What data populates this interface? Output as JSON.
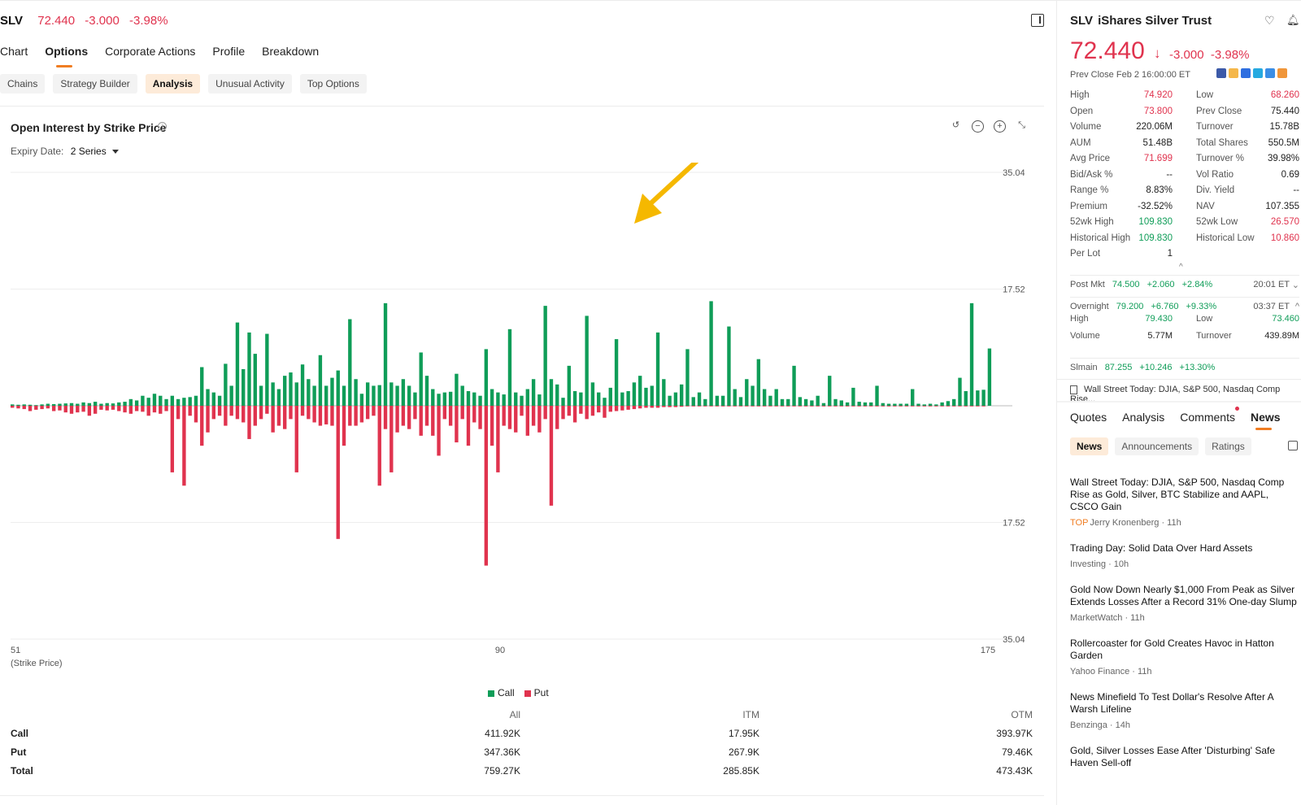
{
  "header": {
    "symbol": "SLV",
    "price": "72.440",
    "change": "-3.000",
    "change_pct": "-3.98%"
  },
  "tabs": [
    {
      "label": "Chart",
      "active": false
    },
    {
      "label": "Options",
      "active": true
    },
    {
      "label": "Corporate Actions",
      "active": false
    },
    {
      "label": "Profile",
      "active": false
    },
    {
      "label": "Breakdown",
      "active": false
    }
  ],
  "subtabs": [
    {
      "label": "Chains",
      "active": false
    },
    {
      "label": "Strategy Builder",
      "active": false
    },
    {
      "label": "Analysis",
      "active": true
    },
    {
      "label": "Unusual Activity",
      "active": false
    },
    {
      "label": "Top Options",
      "active": false
    }
  ],
  "chart_panel": {
    "title": "Open Interest by Strike Price",
    "expiry_label": "Expiry Date:",
    "expiry_value": "2 Series"
  },
  "chart_data": {
    "type": "bar",
    "xlabel": "(Strike Price)",
    "x_ticks": [
      "51",
      "90",
      "175"
    ],
    "y_ticks": [
      "35.04K",
      "17.52K",
      "0",
      "17.52K",
      "35.04K"
    ],
    "ylim": [
      -35040,
      35040
    ],
    "series": [
      {
        "name": "Call",
        "color": "#0f9d58",
        "values": [
          200,
          150,
          200,
          150,
          100,
          200,
          300,
          250,
          300,
          350,
          400,
          300,
          500,
          400,
          600,
          300,
          400,
          350,
          500,
          600,
          1000,
          800,
          1500,
          1200,
          1800,
          1500,
          1000,
          1500,
          1000,
          1200,
          1300,
          1500,
          5800,
          2500,
          2000,
          1500,
          6300,
          3000,
          12500,
          5500,
          11000,
          7800,
          3000,
          10800,
          3500,
          2500,
          4500,
          5000,
          3500,
          6200,
          4000,
          3000,
          7600,
          3000,
          4200,
          5300,
          3000,
          13000,
          4000,
          1800,
          3500,
          3000,
          3100,
          15400,
          3500,
          3000,
          4000,
          3000,
          2000,
          8000,
          4500,
          2500,
          1800,
          2000,
          2100,
          4800,
          3000,
          2200,
          2000,
          1500,
          8500,
          2500,
          2000,
          1700,
          11500,
          2000,
          1500,
          2500,
          4000,
          1700,
          15000,
          4000,
          3200,
          1200,
          6000,
          2200,
          2000,
          13500,
          3500,
          2000,
          1200,
          2700,
          10000,
          2000,
          2200,
          3500,
          4500,
          2700,
          3000,
          11000,
          4000,
          1500,
          2000,
          3200,
          8500,
          1300,
          2000,
          1000,
          15700,
          1500,
          1500,
          11900,
          2500,
          1300,
          4000,
          3000,
          7000,
          2500,
          1500,
          2500,
          1000,
          1000,
          6000,
          1300,
          1000,
          800,
          1500,
          400,
          4500,
          1000,
          800,
          500,
          2700,
          600,
          500,
          500,
          3000,
          400,
          300,
          300,
          300,
          300,
          2500,
          300,
          200,
          300,
          200,
          500,
          700,
          1000,
          4200,
          2200,
          15400,
          2300,
          2400,
          8600
        ]
      },
      {
        "name": "Put",
        "values": [
          300,
          400,
          500,
          800,
          600,
          500,
          400,
          800,
          700,
          1000,
          1200,
          1000,
          900,
          1500,
          1200,
          600,
          700,
          600,
          800,
          1000,
          1200,
          800,
          900,
          1500,
          1000,
          1200,
          800,
          10000,
          2000,
          12000,
          1500,
          2500,
          6000,
          4000,
          2000,
          1500,
          3000,
          1500,
          2000,
          2500,
          5000,
          3000,
          2000,
          1200,
          4000,
          3000,
          3500,
          2000,
          10000,
          1500,
          2000,
          2500,
          3000,
          2800,
          3000,
          20000,
          6000,
          3000,
          3000,
          2500,
          2000,
          1500,
          12000,
          3500,
          10000,
          4000,
          3000,
          3500,
          2000,
          4500,
          3000,
          4500,
          7500,
          2000,
          3000,
          5500,
          2000,
          6000,
          2500,
          3500,
          24000,
          6000,
          10000,
          3000,
          3500,
          4000,
          1500,
          4500,
          3000,
          4000,
          2000,
          15000,
          3500,
          2000,
          1500,
          2500,
          1200,
          2000,
          1500,
          1000,
          1800,
          900,
          800,
          700,
          600,
          500,
          400,
          300,
          300,
          300,
          200,
          200,
          200,
          150,
          100,
          100,
          100,
          100,
          100,
          100,
          100,
          100,
          100,
          100,
          100,
          100,
          100,
          100,
          100,
          100,
          100,
          100,
          100,
          100,
          100,
          100,
          100,
          100,
          100,
          100,
          100,
          100,
          100,
          100,
          100,
          100,
          100,
          100,
          100,
          100,
          100,
          100,
          100,
          100,
          100,
          100,
          100,
          100,
          100,
          100,
          100,
          100,
          100,
          100,
          100
        ]
      }
    ],
    "legend": [
      {
        "name": "Call",
        "color": "#0f9d58"
      },
      {
        "name": "Put",
        "color": "#e0334e"
      }
    ]
  },
  "summary": {
    "headers": [
      "All",
      "ITM",
      "OTM"
    ],
    "rows": [
      {
        "label": "Call",
        "all": "411.92K",
        "itm": "17.95K",
        "otm": "393.97K"
      },
      {
        "label": "Put",
        "all": "347.36K",
        "itm": "267.9K",
        "otm": "79.46K"
      },
      {
        "label": "Total",
        "all": "759.27K",
        "itm": "285.85K",
        "otm": "473.43K"
      }
    ]
  },
  "right_panel": {
    "symbol": "SLV",
    "name": "iShares Silver Trust",
    "price": "72.440",
    "change": "-3.000",
    "change_pct": "-3.98%",
    "prev_close_text": "Prev Close Feb 2 16:00:00 ET",
    "stats": [
      {
        "k1": "High",
        "v1": "74.920",
        "c1": "red",
        "k2": "Low",
        "v2": "68.260",
        "c2": "red"
      },
      {
        "k1": "Open",
        "v1": "73.800",
        "c1": "red",
        "k2": "Prev Close",
        "v2": "75.440",
        "c2": ""
      },
      {
        "k1": "Volume",
        "v1": "220.06M",
        "c1": "",
        "k2": "Turnover",
        "v2": "15.78B",
        "c2": ""
      },
      {
        "k1": "AUM",
        "v1": "51.48B",
        "c1": "",
        "k2": "Total Shares",
        "v2": "550.5M",
        "c2": ""
      },
      {
        "k1": "Avg Price",
        "v1": "71.699",
        "c1": "red",
        "k2": "Turnover %",
        "v2": "39.98%",
        "c2": ""
      },
      {
        "k1": "Bid/Ask %",
        "v1": "--",
        "c1": "",
        "k2": "Vol Ratio",
        "v2": "0.69",
        "c2": ""
      },
      {
        "k1": "Range %",
        "v1": "8.83%",
        "c1": "",
        "k2": "Div. Yield",
        "v2": "--",
        "c2": ""
      },
      {
        "k1": "Premium",
        "v1": "-32.52%",
        "c1": "",
        "k2": "NAV",
        "v2": "107.355",
        "c2": ""
      },
      {
        "k1": "52wk High",
        "v1": "109.830",
        "c1": "green",
        "k2": "52wk Low",
        "v2": "26.570",
        "c2": "red"
      },
      {
        "k1": "Historical High",
        "v1": "109.830",
        "c1": "green",
        "k2": "Historical Low",
        "v2": "10.860",
        "c2": "red"
      },
      {
        "k1": "Per Lot",
        "v1": "1",
        "c1": "",
        "k2": "",
        "v2": "",
        "c2": ""
      }
    ],
    "post_mkt": {
      "label": "Post Mkt",
      "price": "74.500",
      "change": "+2.060",
      "pct": "+2.84%",
      "time": "20:01 ET"
    },
    "overnight": {
      "label": "Overnight",
      "price": "79.200",
      "change": "+6.760",
      "pct": "+9.33%",
      "time": "03:37 ET"
    },
    "overnight_stats": [
      {
        "k1": "High",
        "v1": "79.430",
        "k2": "Low",
        "v2": "73.460"
      },
      {
        "k1": "Volume",
        "v1": "5.77M",
        "k2": "Turnover",
        "v2": "439.89M"
      }
    ],
    "slmain": {
      "label": "Slmain",
      "price": "87.255",
      "change": "+10.246",
      "pct": "+13.30%"
    },
    "news_brief": "Wall Street Today: DJIA, S&P 500, Nasdaq Comp Rise...",
    "tabs": [
      {
        "label": "Quotes",
        "active": false
      },
      {
        "label": "Analysis",
        "active": false
      },
      {
        "label": "Comments",
        "active": false
      },
      {
        "label": "News",
        "active": true
      }
    ],
    "subtabs": [
      {
        "label": "News",
        "active": true
      },
      {
        "label": "Announcements",
        "active": false
      },
      {
        "label": "Ratings",
        "active": false
      }
    ],
    "news": [
      {
        "title": "Wall Street Today: DJIA, S&P 500, Nasdaq Comp Rise as Gold, Silver, BTC Stabilize and AAPL, CSCO Gain",
        "tag": "TOP",
        "meta": "Jerry Kronenberg · 11h"
      },
      {
        "title": "Trading Day: Solid Data Over Hard Assets",
        "tag": "",
        "meta": "Investing · 10h"
      },
      {
        "title": "Gold Now Down Nearly $1,000 From Peak as Silver Extends Losses After a Record 31% One-day Slump",
        "tag": "",
        "meta": "MarketWatch · 11h"
      },
      {
        "title": "Rollercoaster for Gold Creates Havoc in Hatton Garden",
        "tag": "",
        "meta": "Yahoo Finance · 11h"
      },
      {
        "title": "News Minefield To Test Dollar's Resolve After A Warsh Lifeline",
        "tag": "",
        "meta": "Benzinga · 14h"
      },
      {
        "title": "Gold, Silver Losses Ease After 'Disturbing' Safe Haven Sell-off",
        "tag": "",
        "meta": ""
      }
    ]
  },
  "colors": {
    "call": "#0f9d58",
    "put": "#e0334e",
    "accent": "#f07d22",
    "annotation_arrow": "#f5b800"
  }
}
